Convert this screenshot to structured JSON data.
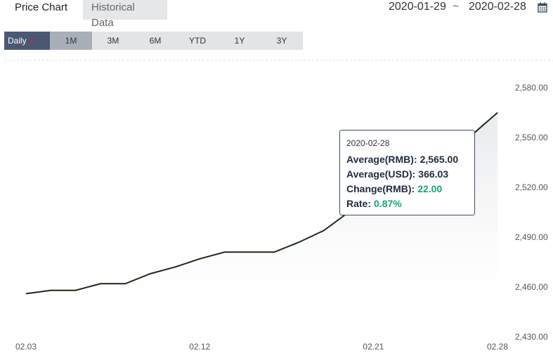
{
  "tabs": {
    "price_chart": "Price Chart",
    "historical_data": "Historical Data"
  },
  "date_range": {
    "from": "2020-01-29",
    "separator": "~",
    "to": "2020-02-28"
  },
  "ranges": {
    "daily": "Daily",
    "m1": "1M",
    "m3": "3M",
    "m6": "6M",
    "ytd": "YTD",
    "y1": "1Y",
    "y3": "3Y"
  },
  "tooltip": {
    "date": "2020-02-28",
    "avg_rmb_label": "Average(RMB):",
    "avg_rmb_value": "2,565.00",
    "avg_usd_label": "Average(USD):",
    "avg_usd_value": "366.03",
    "change_label": "Change(RMB):",
    "change_value": "22.00",
    "rate_label": "Rate:",
    "rate_value": "0.87%"
  },
  "colors": {
    "line": "#1b2a16",
    "accent": "#4b5873",
    "positive": "#17a673"
  },
  "chart_data": {
    "type": "area",
    "x": [
      "02.03",
      "02.04",
      "02.05",
      "02.06",
      "02.07",
      "02.10",
      "02.11",
      "02.12",
      "02.13",
      "02.14",
      "02.17",
      "02.18",
      "02.19",
      "02.20",
      "02.21",
      "02.24",
      "02.25",
      "02.26",
      "02.27",
      "02.28"
    ],
    "x_tick_labels": [
      "02.03",
      "02.12",
      "02.21",
      "02.28"
    ],
    "values": [
      2456,
      2458,
      2458,
      2462,
      2462,
      2468,
      2472,
      2477,
      2481,
      2481,
      2481,
      2487,
      2494,
      2505,
      2514,
      2524,
      2533,
      2543,
      2552,
      2565
    ],
    "ylim": [
      2430,
      2580
    ],
    "y_ticks": [
      2430,
      2460,
      2490,
      2520,
      2550,
      2580
    ],
    "y_tick_labels": [
      "2,430.00",
      "2,460.00",
      "2,490.00",
      "2,520.00",
      "2,550.00",
      "2,580.00"
    ],
    "grid": false,
    "legend": "none"
  }
}
